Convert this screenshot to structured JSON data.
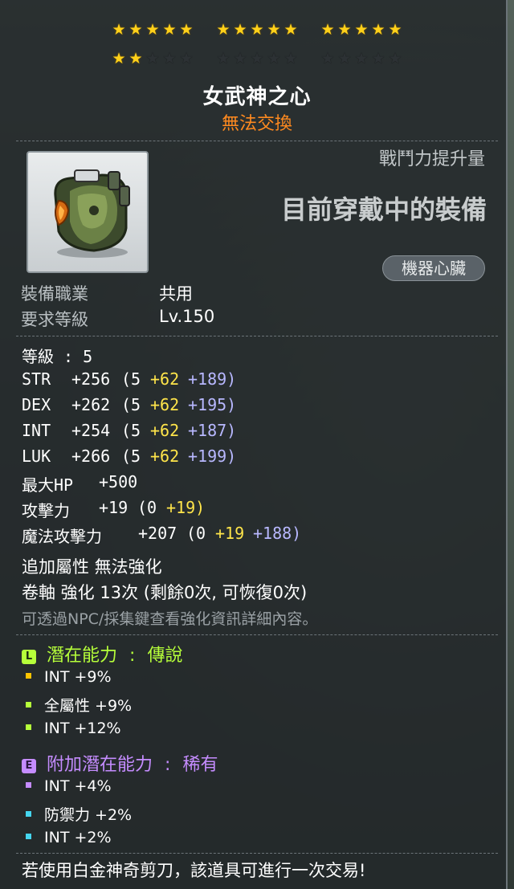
{
  "stars": {
    "row1": {
      "filled": 15,
      "total": 15
    },
    "row2": {
      "filled": 2,
      "total": 15
    }
  },
  "item": {
    "name": "女武神之心",
    "trade_status": "無法交換",
    "combat_power_label": "戰鬥力提升量",
    "equipped_label": "目前穿戴中的裝備",
    "type_tag": "機器心臟",
    "icon": "mechanical-heart-icon"
  },
  "requirements": {
    "job_label": "裝備職業",
    "job_value": "共用",
    "level_label": "要求等級",
    "level_value": "Lv.150"
  },
  "stats": {
    "level": "等級 : 5",
    "str": {
      "name": "STR",
      "total": "+256",
      "base": "(5",
      "bonus": "+62",
      "star": "+189)"
    },
    "dex": {
      "name": "DEX",
      "total": "+262",
      "base": "(5",
      "bonus": "+62",
      "star": "+195)"
    },
    "int": {
      "name": "INT",
      "total": "+254",
      "base": "(5",
      "bonus": "+62",
      "star": "+187)"
    },
    "luk": {
      "name": "LUK",
      "total": "+266",
      "base": "(5",
      "bonus": "+62",
      "star": "+199)"
    },
    "max_hp": {
      "name": "最大HP",
      "total": "+500"
    },
    "attack": {
      "name": "攻擊力",
      "total": "+19",
      "base": "(0",
      "bonus": "+19)"
    },
    "magic_attack": {
      "name": "魔法攻擊力",
      "total": "+207",
      "base": "(0",
      "bonus": "+19",
      "star": "+188)"
    }
  },
  "extra": {
    "additional_attr": "追加屬性 無法強化",
    "scroll": "卷軸 強化 13次 (剩餘0次, 可恢復0次)",
    "npc_note": "可透過NPC/採集鍵查看強化資訊詳細內容。"
  },
  "potential": {
    "badge": "L",
    "title": "潛在能力",
    "separator": ":",
    "grade": "傳說",
    "lines": [
      "INT +9%",
      "全屬性 +9%",
      "INT +12%"
    ],
    "colors": {
      "title": "#b6ff3a",
      "grade": "#b6ff3a"
    }
  },
  "bonus_potential": {
    "badge": "E",
    "title": "附加潛在能力",
    "separator": ":",
    "grade": "稀有",
    "lines": [
      "INT +4%",
      "防禦力 +2%",
      "INT +2%"
    ],
    "colors": {
      "title": "#c58cff",
      "grade": "#c58cff"
    }
  },
  "footer": "若使用白金神奇剪刀，該道具可進行一次交易!"
}
